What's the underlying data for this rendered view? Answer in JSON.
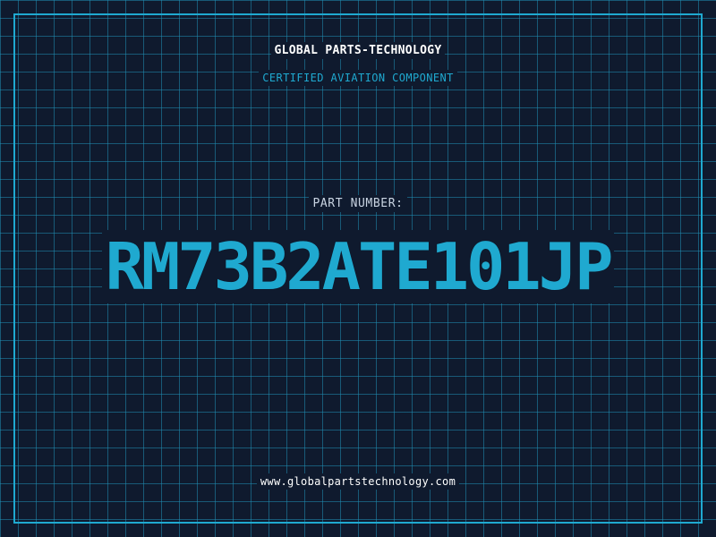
{
  "brand": {
    "company_name": "GLOBAL PARTS-TECHNOLOGY",
    "tagline": "CERTIFIED AVIATION COMPONENT"
  },
  "part": {
    "label": "PART NUMBER:",
    "number": "RM73B2ATE101JP"
  },
  "footer": {
    "website": "www.globalpartstechnology.com"
  },
  "colors": {
    "background": "#0f1a2e",
    "grid": "#1f8db3",
    "accent": "#1fa9d0",
    "brand_text": "#ffffff",
    "label_text": "#c9d4e2",
    "footer_text": "#ffffff"
  }
}
